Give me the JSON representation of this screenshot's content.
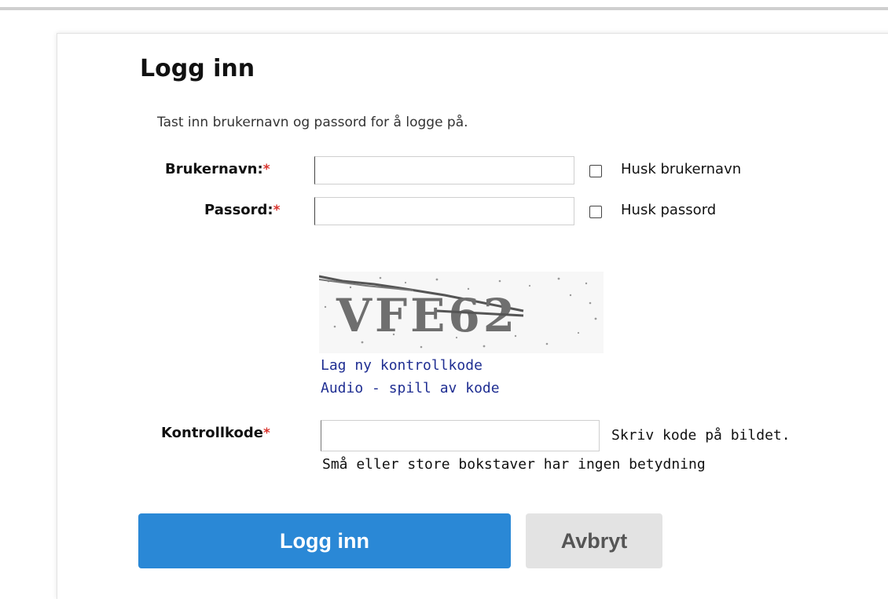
{
  "form": {
    "title": "Logg inn",
    "intro": "Tast inn brukernavn og passord for å logge på.",
    "required_marker": "*",
    "username": {
      "label": "Brukernavn:",
      "value": "",
      "remember_label": "Husk brukernavn",
      "remember_checked": false
    },
    "password": {
      "label": "Passord:",
      "value": "",
      "remember_label": "Husk passord",
      "remember_checked": false
    },
    "captcha": {
      "image_text": "VFE62",
      "new_code_link": "Lag ny kontrollkode",
      "audio_link": "Audio - spill av kode"
    },
    "control_code": {
      "label": "Kontrollkode",
      "value": "",
      "hint1": "Skriv kode på bildet.",
      "hint2": "Små eller store bokstaver har ingen betydning"
    },
    "buttons": {
      "login": "Logg inn",
      "cancel": "Avbryt"
    }
  },
  "colors": {
    "primary_button": "#2a88d6",
    "secondary_button": "#e3e3e3",
    "link": "#1f2e92",
    "required": "#d9352f"
  }
}
